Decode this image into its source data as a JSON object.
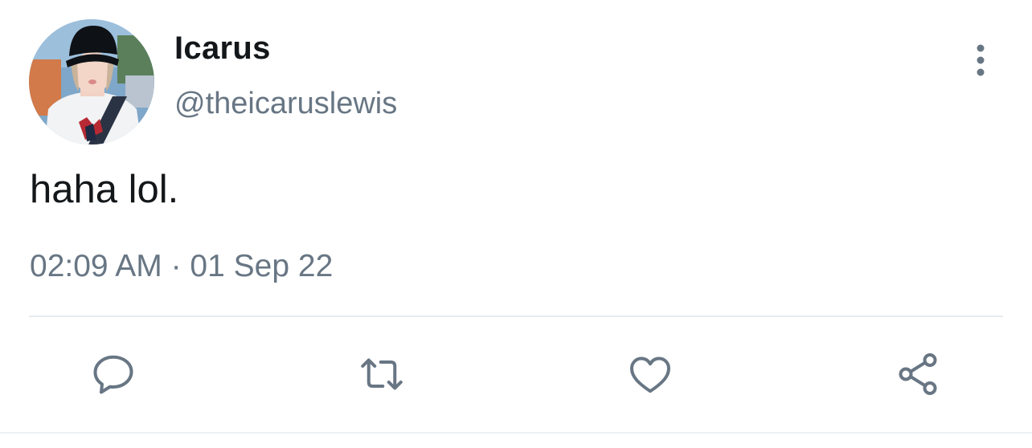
{
  "tweet": {
    "display_name": "Icarus",
    "handle": "@theicaruslewis",
    "text": "haha lol.",
    "timestamp": "02:09 AM · 01 Sep 22"
  },
  "icons": {
    "more": "more-vertical-icon",
    "reply": "reply-icon",
    "retweet": "retweet-icon",
    "like": "heart-icon",
    "share": "share-icon"
  },
  "colors": {
    "text_primary": "#14171a",
    "text_secondary": "#687684",
    "icon": "#687684",
    "divider": "#e6ecf0"
  }
}
